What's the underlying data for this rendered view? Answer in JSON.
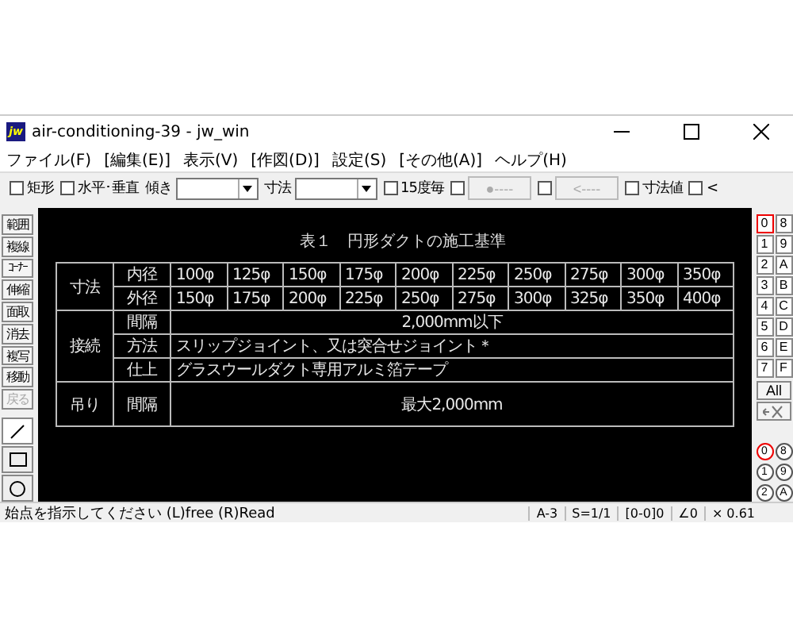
{
  "window": {
    "title": "air-conditioning-39 - jw_win",
    "icon": "jw"
  },
  "menu": [
    "ファイル(F)",
    "[編集(E)]",
    "表示(V)",
    "[作図(D)]",
    "設定(S)",
    "[その他(A)]",
    "ヘルプ(H)"
  ],
  "toolbar": [
    {
      "kind": "check",
      "label": "矩形",
      "checked": false
    },
    {
      "kind": "check",
      "label": "水平･垂直",
      "checked": false
    },
    {
      "kind": "combo",
      "label": "傾き"
    },
    {
      "kind": "combo",
      "label": "寸法"
    },
    {
      "kind": "check",
      "label": "15度毎",
      "checked": false
    },
    {
      "kind": "checkbutton",
      "label": "●----",
      "checked": false,
      "disabled": true
    },
    {
      "kind": "checkbutton",
      "label": "<----",
      "checked": false,
      "disabled": true
    },
    {
      "kind": "check",
      "label": "寸法値",
      "checked": false
    },
    {
      "kind": "check",
      "label": "<",
      "checked": false
    }
  ],
  "tools": [
    {
      "label": "範囲",
      "disabled": false
    },
    {
      "label": "複線",
      "disabled": false
    },
    {
      "label": "ｺｰﾅｰ",
      "disabled": false
    },
    {
      "label": "伸縮",
      "disabled": false
    },
    {
      "label": "面取",
      "disabled": false
    },
    {
      "label": "消去",
      "disabled": false
    },
    {
      "label": "複写",
      "disabled": false
    },
    {
      "label": "移動",
      "disabled": false
    },
    {
      "label": "戻る",
      "disabled": true
    }
  ],
  "draw_tools": [
    {
      "kind": "line",
      "selected": true
    },
    {
      "kind": "rect",
      "selected": false
    },
    {
      "kind": "circle",
      "selected": false
    }
  ],
  "drawing": {
    "title": "表１　円形ダクトの施工基準",
    "groups": [
      {
        "label": "寸法",
        "rows": [
          {
            "label": "内径",
            "kind": "values",
            "cells": [
              "100φ",
              "125φ",
              "150φ",
              "175φ",
              "200φ",
              "225φ",
              "250φ",
              "275φ",
              "300φ",
              "350φ"
            ]
          },
          {
            "label": "外径",
            "kind": "values",
            "cells": [
              "150φ",
              "175φ",
              "200φ",
              "225φ",
              "250φ",
              "275φ",
              "300φ",
              "325φ",
              "350φ",
              "400φ"
            ]
          }
        ]
      },
      {
        "label": "接続",
        "rows": [
          {
            "label": "間隔",
            "kind": "center",
            "text": "2,000mm以下"
          },
          {
            "label": "方法",
            "kind": "left",
            "text": "スリップジョイント、又は突合せジョイント＊"
          },
          {
            "label": "仕上",
            "kind": "left",
            "text": "グラスウールダクト専用アルミ箔テープ"
          }
        ]
      },
      {
        "label": "吊り",
        "rows": [
          {
            "label": "間隔",
            "kind": "tall",
            "text": "最大2,000mm"
          }
        ]
      }
    ]
  },
  "layers": [
    {
      "label": "0",
      "selected": true
    },
    {
      "label": "8",
      "selected": false
    },
    {
      "label": "1",
      "selected": false
    },
    {
      "label": "9",
      "selected": false
    },
    {
      "label": "2",
      "selected": false
    },
    {
      "label": "A",
      "selected": false
    },
    {
      "label": "3",
      "selected": false
    },
    {
      "label": "B",
      "selected": false
    },
    {
      "label": "4",
      "selected": false
    },
    {
      "label": "C",
      "selected": false
    },
    {
      "label": "5",
      "selected": false
    },
    {
      "label": "D",
      "selected": false
    },
    {
      "label": "6",
      "selected": false
    },
    {
      "label": "E",
      "selected": false
    },
    {
      "label": "7",
      "selected": false
    },
    {
      "label": "F",
      "selected": false
    }
  ],
  "layer_all": "All",
  "layer_groups": [
    {
      "label": "0",
      "selected": true
    },
    {
      "label": "8",
      "selected": false
    },
    {
      "label": "1",
      "selected": false
    },
    {
      "label": "9",
      "selected": false
    },
    {
      "label": "2",
      "selected": false
    },
    {
      "label": "A",
      "selected": false
    }
  ],
  "status_bar": {
    "message": "始点を指示してください (L)free (R)Read",
    "fields": [
      "A-3",
      "S=1/1",
      "[0-0]0",
      "∠0",
      "× 0.61"
    ]
  }
}
